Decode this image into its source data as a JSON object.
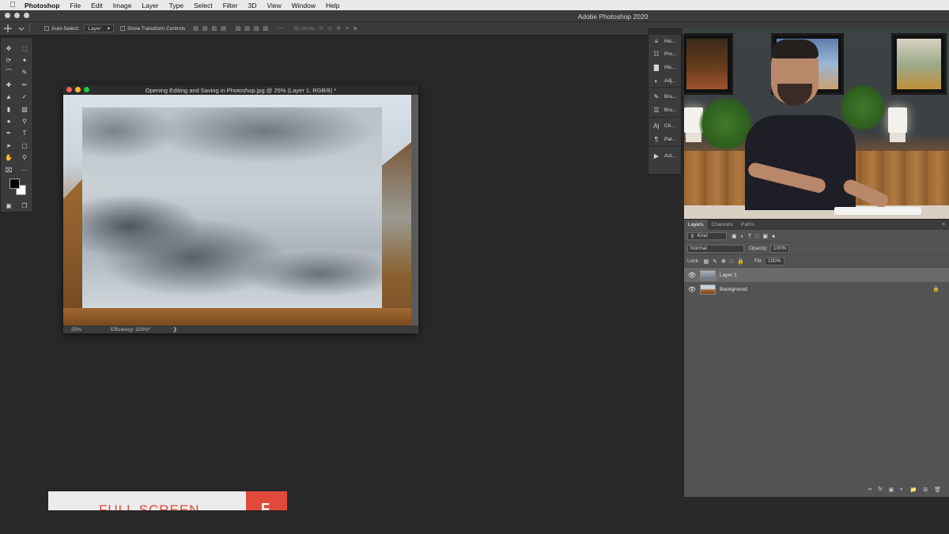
{
  "menubar": {
    "app": "Photoshop",
    "items": [
      "File",
      "Edit",
      "Image",
      "Layer",
      "Type",
      "Select",
      "Filter",
      "3D",
      "View",
      "Window",
      "Help"
    ]
  },
  "app_title": "Adobe Photoshop 2020",
  "options": {
    "auto_select_label": "Auto-Select:",
    "auto_select_value": "Layer",
    "show_transform_label": "Show Transform Controls",
    "mode_3d_label": "3D Mode:"
  },
  "document": {
    "title": "Opening Editing and Saving in Photoshop.jpg @ 25% (Layer 1, RGB/8) *",
    "zoom": "25%",
    "efficiency": "Efficiency: 100%*",
    "status_arrow": "❯"
  },
  "dock": {
    "items": [
      {
        "icon": "≡",
        "label": "His..."
      },
      {
        "icon": "☷",
        "label": "Pro..."
      },
      {
        "icon": "▇",
        "label": "His..."
      },
      {
        "icon": "◐",
        "label": "Adj..."
      },
      {
        "icon": "✎",
        "label": "Bru..."
      },
      {
        "icon": "☰",
        "label": "Bru..."
      },
      {
        "icon": "A|",
        "label": "Ch..."
      },
      {
        "icon": "¶",
        "label": "Par..."
      },
      {
        "icon": "▶",
        "label": "Act..."
      }
    ]
  },
  "layers_panel": {
    "tabs": [
      "Layers",
      "Channels",
      "Paths"
    ],
    "kind_label": "Kind",
    "blend_mode": "Normal",
    "opacity_label": "Opacity:",
    "opacity_value": "100%",
    "lock_label": "Lock:",
    "fill_label": "Fill:",
    "fill_value": "100%",
    "layers": [
      {
        "name": "Layer 1",
        "selected": true
      },
      {
        "name": "Background",
        "selected": false
      }
    ]
  },
  "banner": {
    "text": "FULL SCREEN",
    "key": "F"
  },
  "colors": {
    "accent_red": "#e04a3a",
    "panel_bg": "#3b3b3b",
    "workspace_bg": "#282828"
  }
}
